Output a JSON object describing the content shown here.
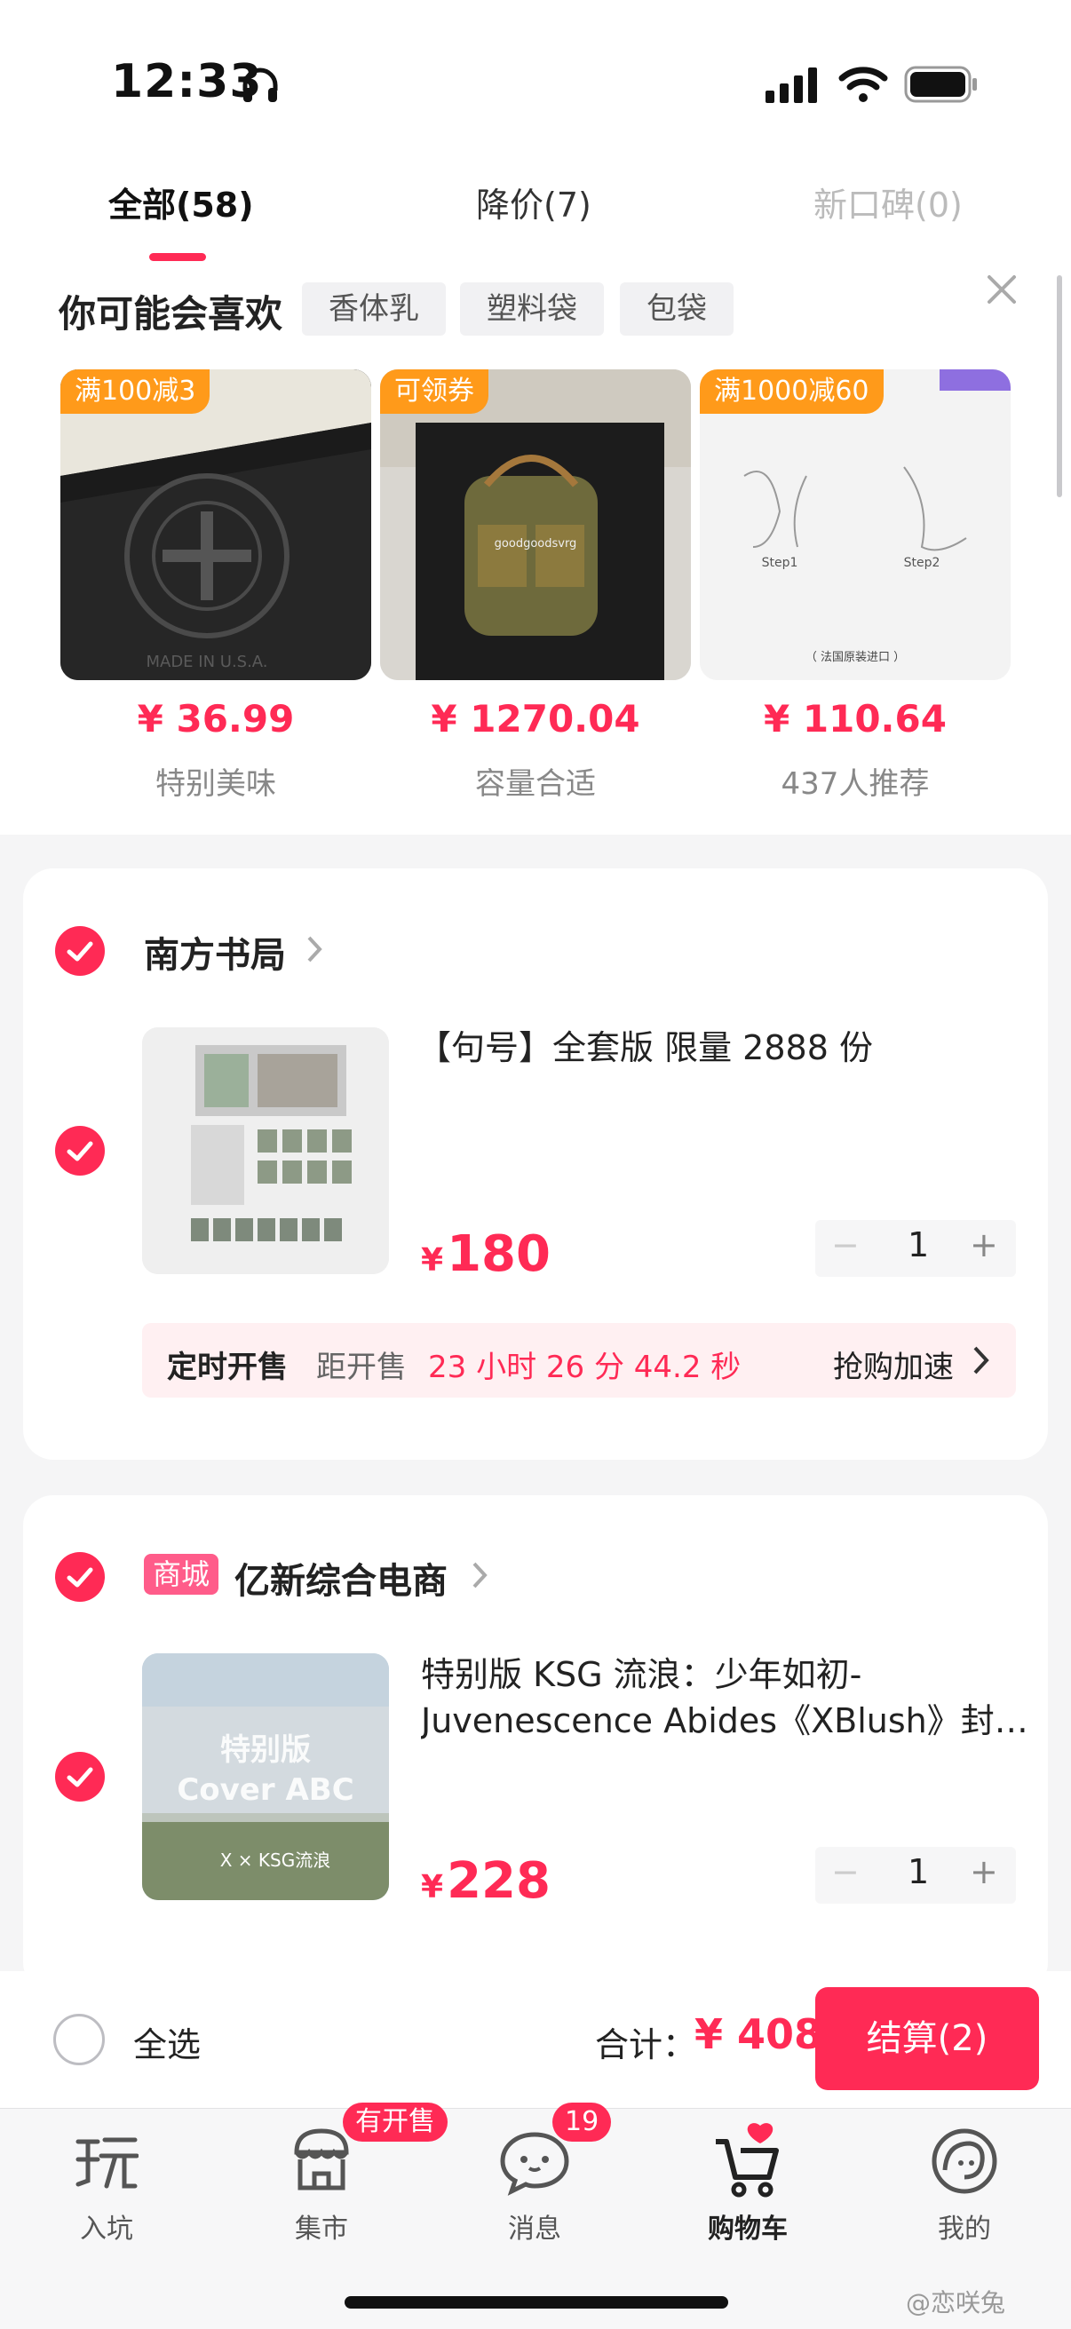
{
  "status_bar": {
    "time": "12:33"
  },
  "tabs": [
    {
      "label": "全部(58)"
    },
    {
      "label": "降价(7)"
    },
    {
      "label": "新口碑(0)"
    }
  ],
  "recommend": {
    "title": "你可能会喜欢",
    "chips": [
      "香体乳",
      "塑料袋",
      "包袋"
    ],
    "items": [
      {
        "tag": "满100减3",
        "price": "¥ 36.99",
        "subtitle": "特别美味",
        "image_text": "MADE IN U.S.A."
      },
      {
        "tag": "可领券",
        "price": "¥ 1270.04",
        "subtitle": "容量合适",
        "image_text": "goodgoodsvrg"
      },
      {
        "tag": "满1000减60",
        "price": "¥ 110.64",
        "subtitle": "437人推荐",
        "image_text": {
          "step1": "Step1",
          "step2": "Step2",
          "origin": "（ 法国原装进口 ）"
        }
      }
    ]
  },
  "shops": [
    {
      "name": "南方书局",
      "badge": "",
      "item": {
        "title": "【句号】全套版 限量 2888 份",
        "currency": "¥",
        "price": "180",
        "quantity": "1"
      },
      "timer": {
        "label": "定时开售",
        "prefix": "距开售",
        "countdown": "23 小时 26 分 44.2 秒",
        "action": "抢购加速"
      }
    },
    {
      "name": "亿新综合电商",
      "badge": "商城",
      "item": {
        "title_line1": "特别版  KSG 流浪：少年如初-",
        "title_line2": "Juvenescence Abides《XBlush》封…",
        "currency": "¥",
        "price": "228",
        "quantity": "1",
        "image_text": {
          "line1": "特别版",
          "line2": "Cover ABC",
          "line3": "X  ×  KSG流浪"
        }
      }
    }
  ],
  "checkout": {
    "select_all": "全选",
    "total_label": "合计：",
    "total": "¥ 408",
    "button": "结算(2)"
  },
  "nav": [
    {
      "label": "入坑",
      "icon": "play-icon",
      "badge": ""
    },
    {
      "label": "集市",
      "icon": "market-icon",
      "badge": "有开售"
    },
    {
      "label": "消息",
      "icon": "message-icon",
      "badge": "19"
    },
    {
      "label": "购物车",
      "icon": "cart-icon",
      "badge": ""
    },
    {
      "label": "我的",
      "icon": "profile-icon",
      "badge": ""
    }
  ],
  "watermark": "@恋咲兔",
  "colors": {
    "accent": "#ff2a55",
    "tag_orange": "#ff9a1a",
    "badge_pink": "#ff5c8a"
  }
}
